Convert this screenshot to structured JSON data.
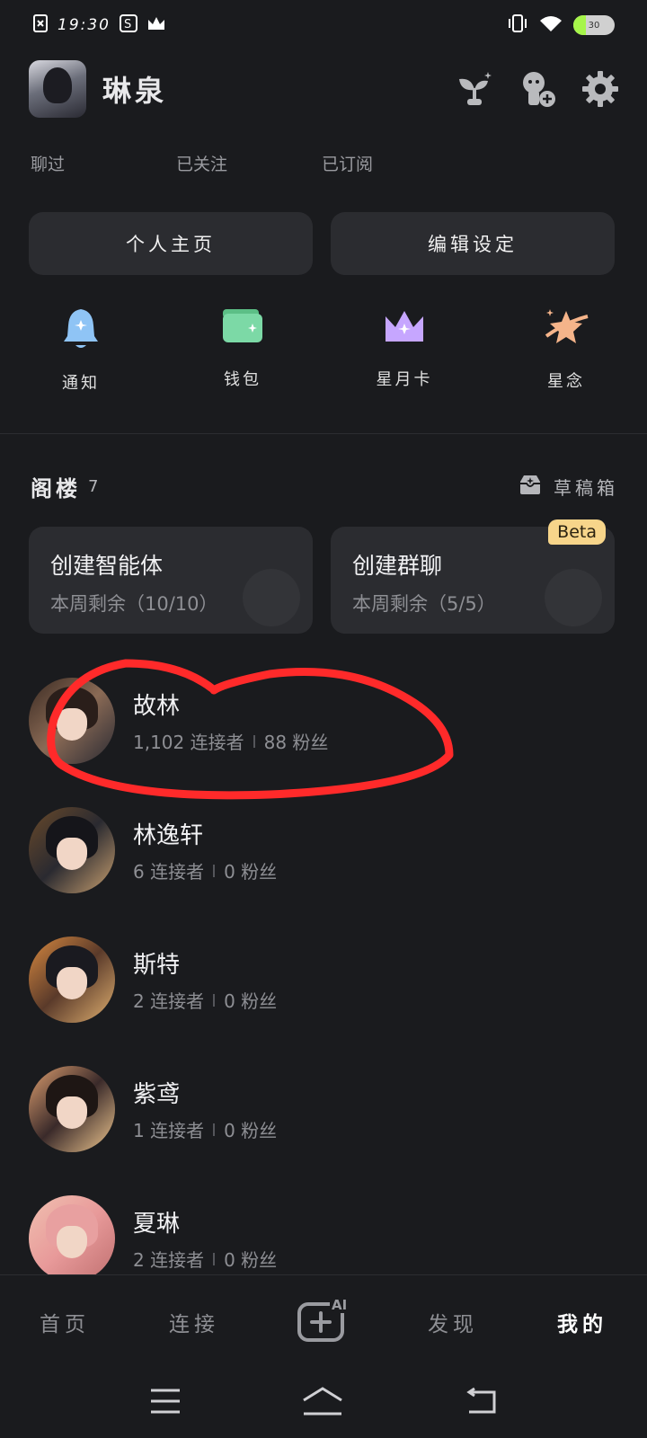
{
  "status": {
    "time": "19:30",
    "battery": "30",
    "battery_level": 0.3
  },
  "profile": {
    "name": "琳泉"
  },
  "stats": [
    "聊过",
    "已关注",
    "已订阅"
  ],
  "actions": {
    "home": "个人主页",
    "edit": "编辑设定"
  },
  "quick": [
    {
      "label": "通知",
      "icon": "bell-icon",
      "color": "#8fc4f5"
    },
    {
      "label": "钱包",
      "icon": "wallet-icon",
      "color": "#7cd9a6"
    },
    {
      "label": "星月卡",
      "icon": "crown-icon",
      "color": "#c6a6ff"
    },
    {
      "label": "星念",
      "icon": "star-orbit-icon",
      "color": "#f5b48a"
    }
  ],
  "section": {
    "title": "阁楼",
    "count": "7",
    "drafts": "草稿箱"
  },
  "create": {
    "agent_title": "创建智能体",
    "agent_sub": "本周剩余（10/10）",
    "group_title": "创建群聊",
    "group_sub": "本周剩余（5/5）",
    "beta": "Beta"
  },
  "characters": [
    {
      "name": "故林",
      "connectors": "1,102 连接者",
      "fans": "88 粉丝"
    },
    {
      "name": "林逸轩",
      "connectors": "6 连接者",
      "fans": "0 粉丝"
    },
    {
      "name": "斯特",
      "connectors": "2 连接者",
      "fans": "0 粉丝"
    },
    {
      "name": "紫鸢",
      "connectors": "1 连接者",
      "fans": "0 粉丝"
    },
    {
      "name": "夏琳",
      "connectors": "2 连接者",
      "fans": "0 粉丝"
    }
  ],
  "nav": {
    "home": "首页",
    "connect": "连接",
    "create_ai": "AI",
    "discover": "发现",
    "mine": "我的"
  },
  "colors": {
    "background": "#1a1b1e",
    "card": "#2b2c30",
    "annotation": "#ff2a2a",
    "beta_bg": "#f7d58a"
  }
}
